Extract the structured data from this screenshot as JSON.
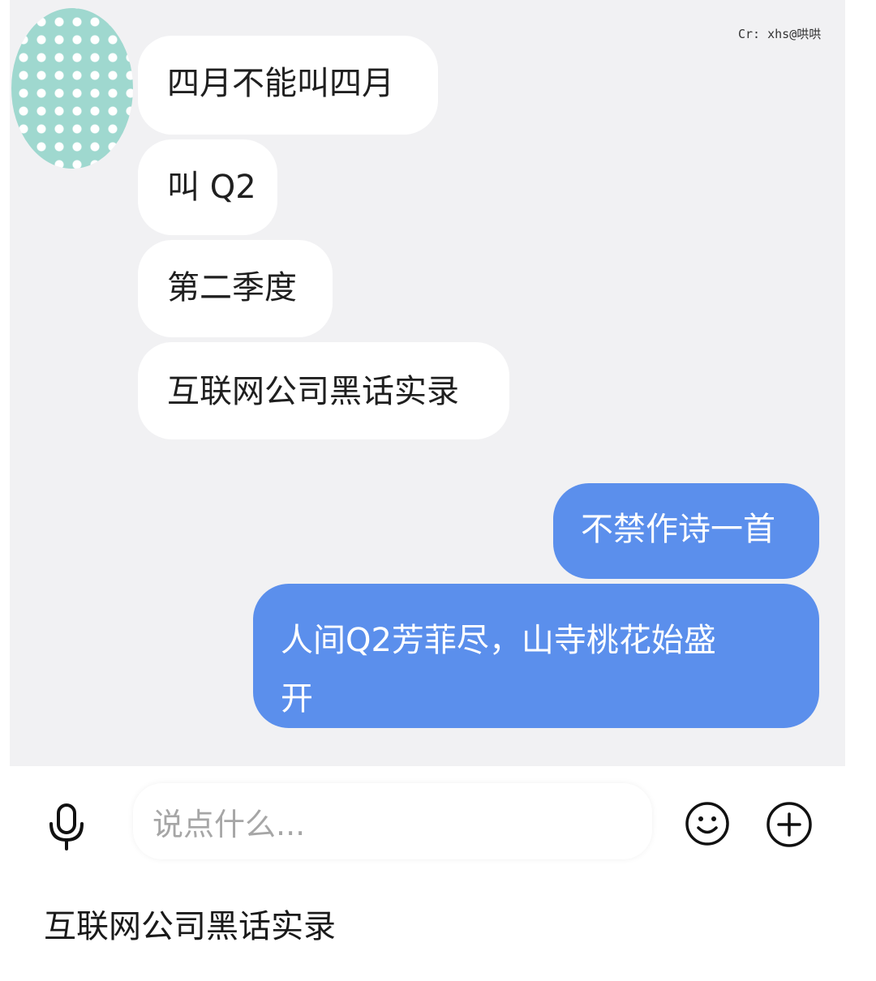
{
  "watermark": "Cr: xhs@哄哄",
  "avatar": {
    "icon": "polka-dot-avatar",
    "colors": {
      "base": "#9fd8cf",
      "dots": "#ffffff"
    }
  },
  "messages": [
    {
      "side": "incoming",
      "text": "四月不能叫四月"
    },
    {
      "side": "incoming",
      "text": "叫 Q2"
    },
    {
      "side": "incoming",
      "text": "第二季度"
    },
    {
      "side": "incoming",
      "text": "互联网公司黑话实录"
    },
    {
      "side": "outgoing",
      "text": "不禁作诗一首"
    },
    {
      "side": "outgoing",
      "lines": [
        "人间Q2芳菲尽，山寺桃花始盛",
        "开"
      ]
    }
  ],
  "input": {
    "placeholder": "说点什么...",
    "mic_icon": "microphone-icon",
    "emoji_icon": "smiley-icon",
    "plus_icon": "plus-circle-icon"
  },
  "footer": {
    "title": "互联网公司黑话实录"
  },
  "colors": {
    "chat_bg": "#f1f1f3",
    "incoming_bubble": "#ffffff",
    "outgoing_bubble": "#5b8fec"
  }
}
